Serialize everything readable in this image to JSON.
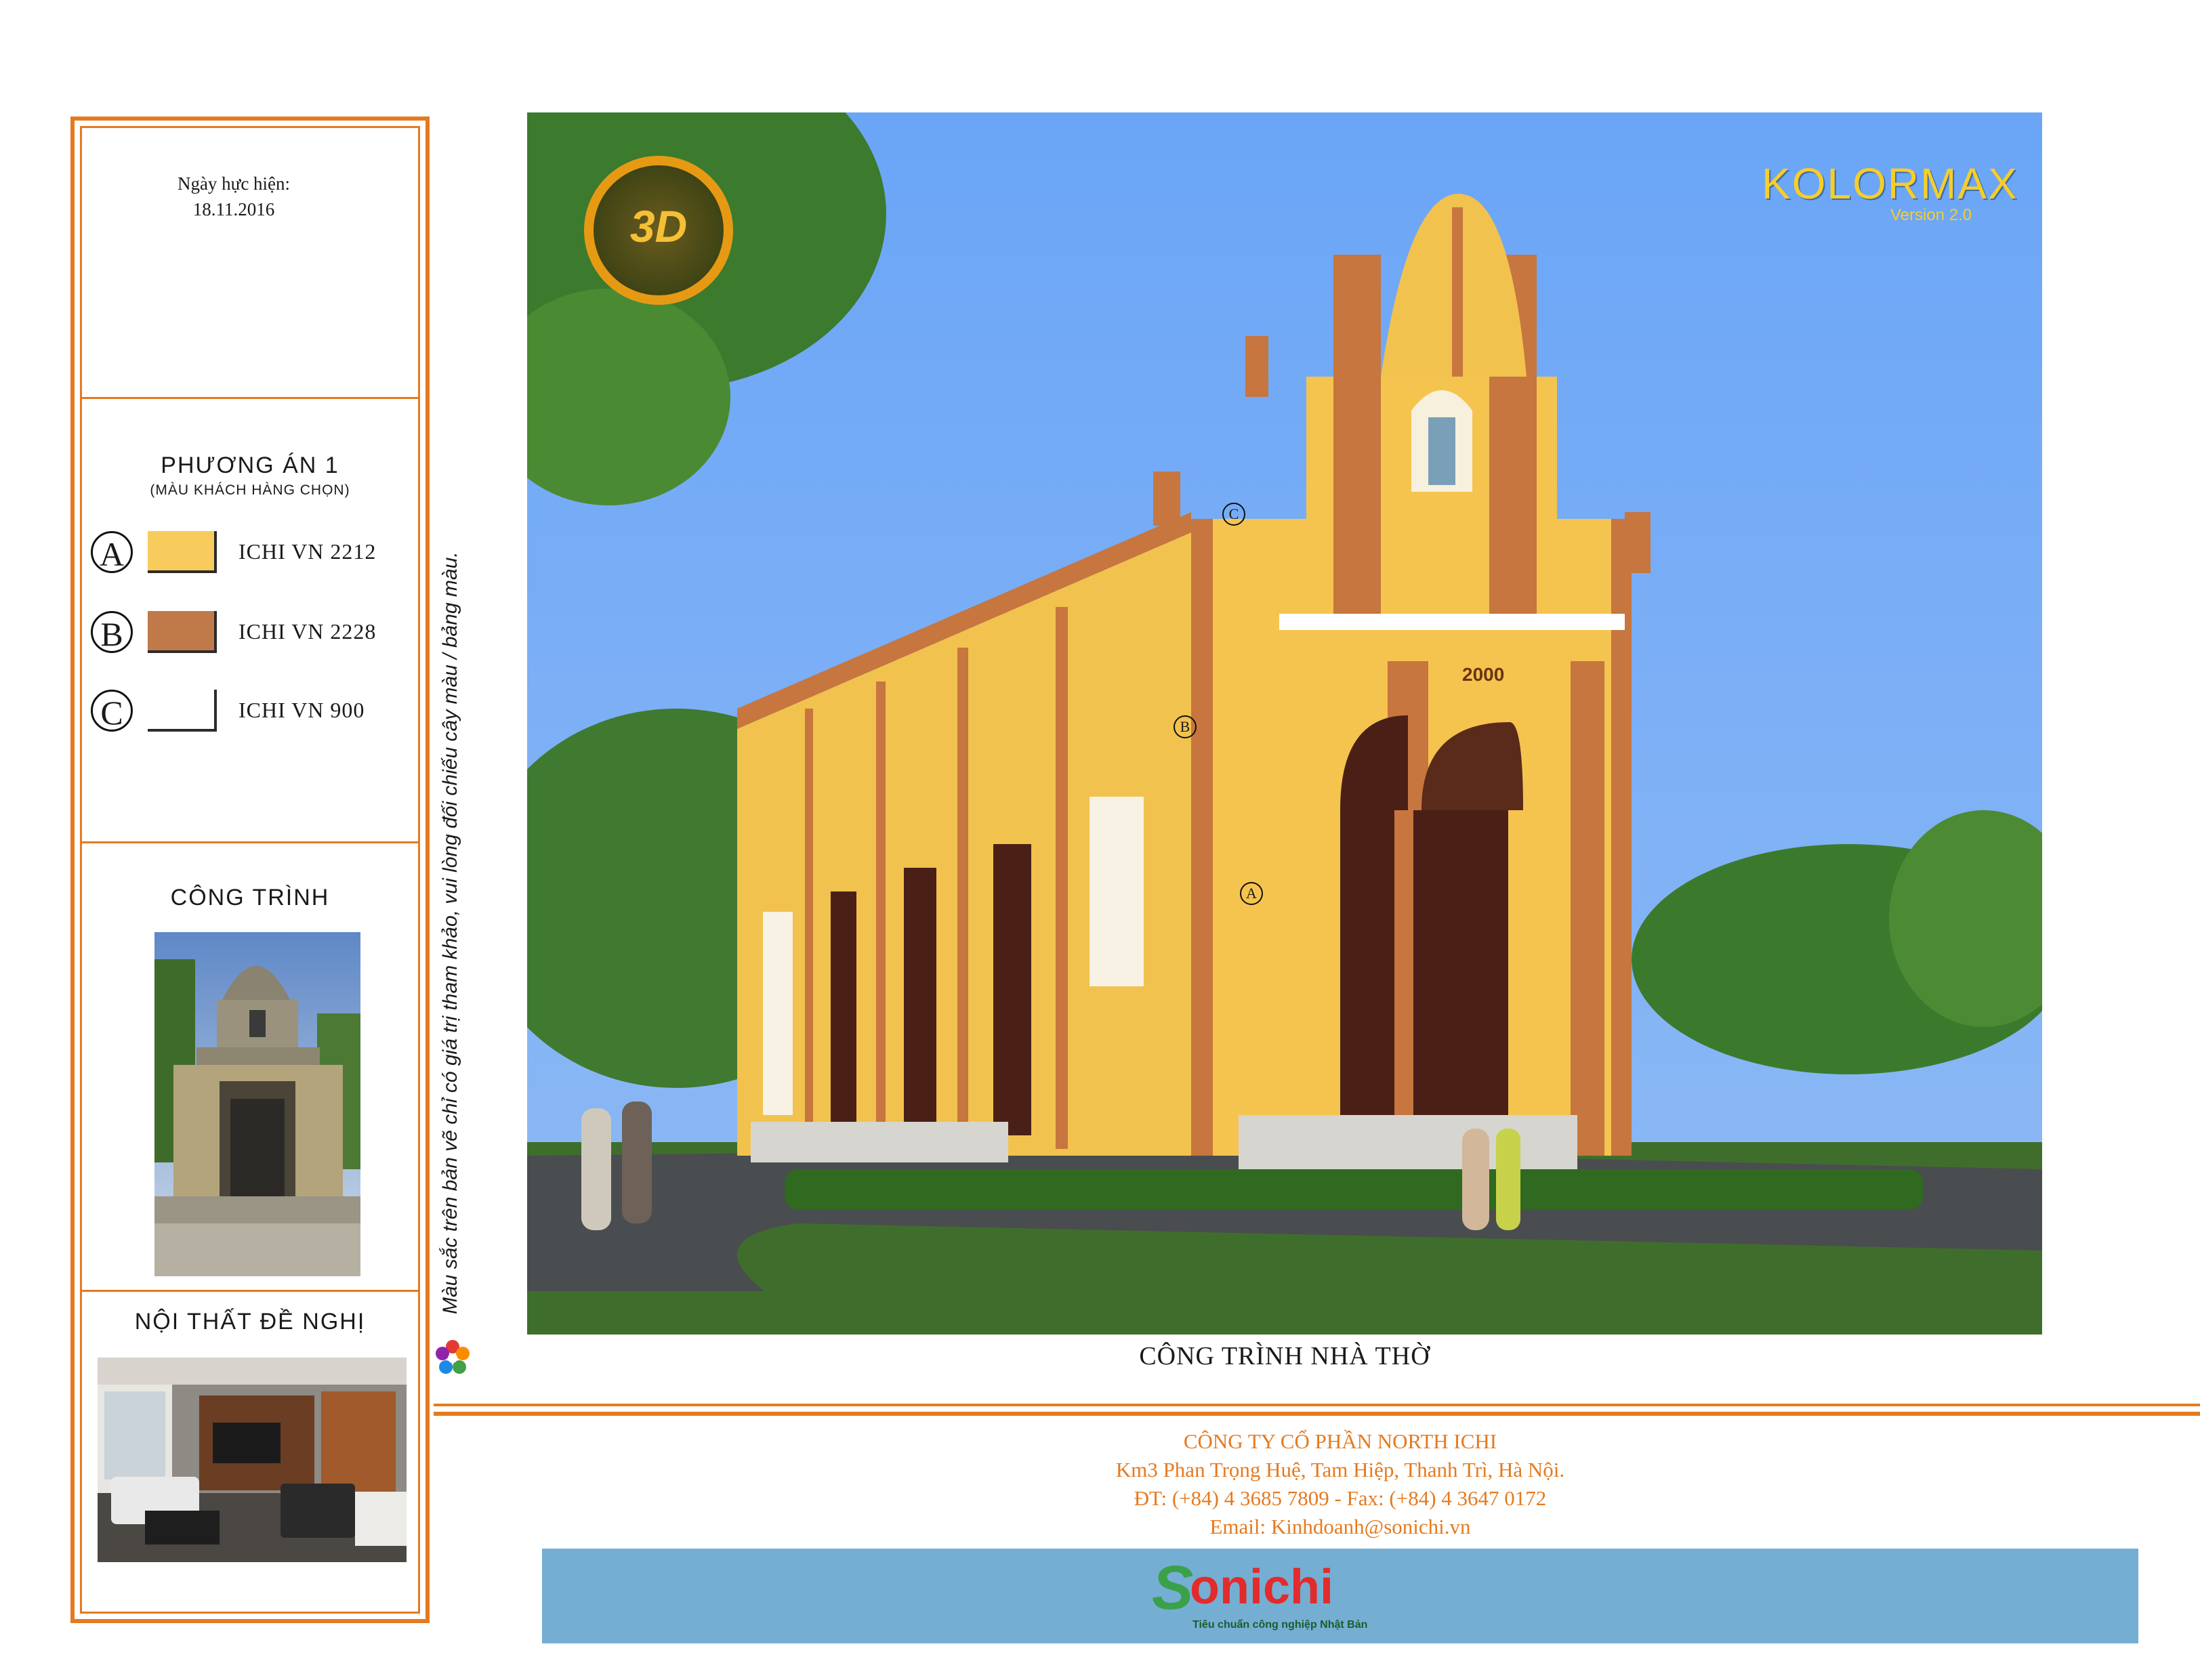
{
  "info": {
    "date_label": "Ngày hực hiện:",
    "date_value": "18.11.2016"
  },
  "palette": {
    "title": "PHƯƠNG ÁN 1",
    "subtitle": "(MÀU KHÁCH HÀNG CHỌN)",
    "items": [
      {
        "letter": "A",
        "code": "ICHI VN 2212",
        "color": "#f7cb5c"
      },
      {
        "letter": "B",
        "code": "ICHI VN 2228",
        "color": "#c07a4a"
      },
      {
        "letter": "C",
        "code": "ICHI VN 900",
        "color": "#ffffff"
      }
    ]
  },
  "building_section": {
    "title": "CÔNG TRÌNH"
  },
  "interior_section": {
    "title": "NỘI THẤT ĐỀ NGHỊ"
  },
  "disclaimer": "Màu sắc trên bản vẽ chỉ có giá trị tham khảo, vui lòng đối chiếu cây màu / bảng màu.",
  "render": {
    "caption": "CÔNG TRÌNH NHÀ THỜ",
    "year_plaque": "2000",
    "brand_main": "KOLORMAX",
    "brand_version": "Version 2.0",
    "badge_text": "3D",
    "markers": [
      "A",
      "B",
      "C"
    ]
  },
  "company": {
    "name": "CÔNG TY CỔ PHẦN NORTH ICHI",
    "address": "Km3 Phan Trọng Huệ, Tam Hiệp, Thanh Trì, Hà Nội.",
    "phone": "ĐT: (+84) 4 3685 7809 - Fax: (+84) 4 3647 0172",
    "email": "Email: Kinhdoanh@sonichi.vn"
  },
  "logo": {
    "text": "onichi",
    "initial": "S",
    "tagline": "Tiêu chuẩn công nghiệp Nhật Bản"
  },
  "colors": {
    "frame_orange": "#e57a1f",
    "sky": "#7aaef7",
    "banner_blue": "#75aed3",
    "logo_red": "#e32b2b",
    "logo_green": "#3aa14a"
  }
}
